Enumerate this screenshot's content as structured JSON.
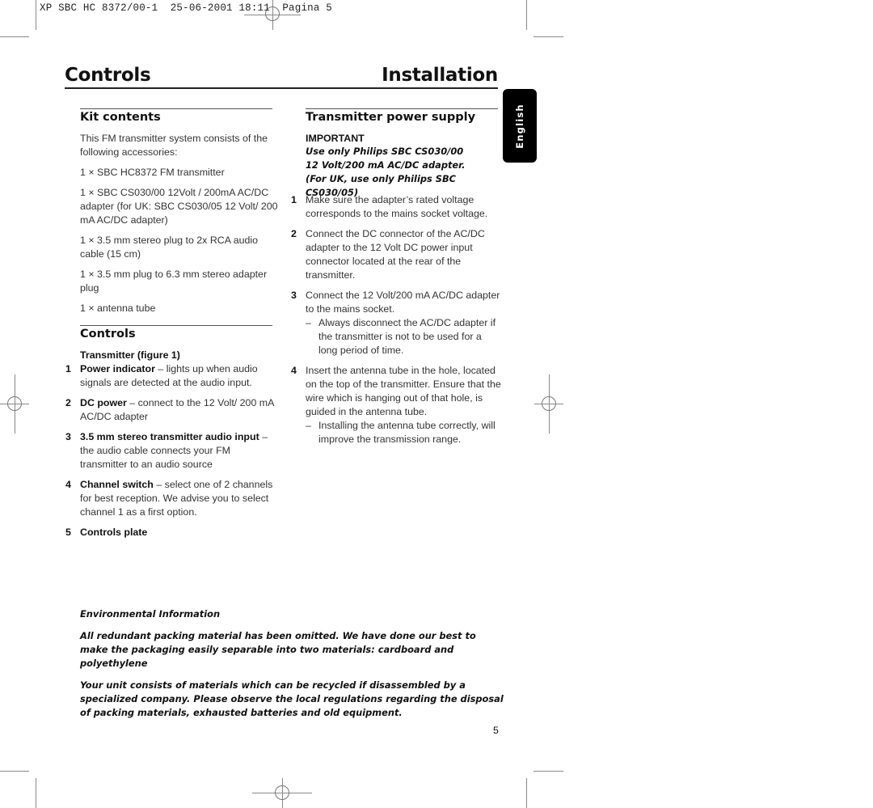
{
  "slug": {
    "text": "XP SBC HC 8372/00-1  25-06-2001 18:11  Pagina 5"
  },
  "header": {
    "left_title": "Controls",
    "right_title": "Installation"
  },
  "language_tab": {
    "label": "English",
    "color": "#000000"
  },
  "kit_contents": {
    "heading": "Kit contents",
    "intro": "This FM transmitter system consists of the following accessories:",
    "items": [
      "1 × SBC HC8372 FM transmitter",
      "1 × SBC CS030/00 12Volt / 200mA AC/DC adapter (for UK: SBC CS030/05 12 Volt/ 200 mA AC/DC adapter)",
      "1 × 3.5 mm stereo plug to 2x RCA audio cable (15 cm)",
      "1 × 3.5 mm plug to 6.3 mm stereo adapter plug",
      "1 × antenna tube"
    ]
  },
  "controls": {
    "heading": "Controls",
    "subheading": "Transmitter (figure 1)",
    "items": [
      {
        "num": "1",
        "term": "Power indicator",
        "desc": " – lights up when audio signals are detected at the audio input."
      },
      {
        "num": "2",
        "term": "DC power",
        "desc": " – connect to the 12 Volt/ 200 mA AC/DC adapter"
      },
      {
        "num": "3",
        "term": "3.5 mm stereo transmitter audio input",
        "desc": " – the audio cable connects your FM transmitter to an audio source"
      },
      {
        "num": "4",
        "term": "Channel switch",
        "desc": " – select one of 2 channels for best reception. We advise you to select channel 1 as a first option."
      },
      {
        "num": "5",
        "term": "Controls plate",
        "desc": ""
      }
    ]
  },
  "power_supply": {
    "heading": "Transmitter power supply",
    "important_label": "IMPORTANT",
    "important_lines": [
      "Use only Philips SBC CS030/00",
      "12 Volt/200 mA AC/DC adapter.",
      "(For UK, use only Philips SBC CS030/05)"
    ],
    "steps": [
      {
        "num": "1",
        "text": "Make sure the adapter’s rated voltage corresponds to the mains socket voltage.",
        "note": ""
      },
      {
        "num": "2",
        "text": "Connect the DC connector of the AC/DC adapter to the 12 Volt DC power input connector located at the rear of the transmitter.",
        "note": ""
      },
      {
        "num": "3",
        "text": "Connect the 12 Volt/200 mA AC/DC adapter to the mains socket.",
        "note": "Always disconnect the AC/DC adapter if the transmitter is not to be used for a long period of time."
      },
      {
        "num": "4",
        "text": "Insert the antenna tube in the hole, located on the top of the transmitter. Ensure that the wire which is hanging out of that hole, is guided in the antenna tube.",
        "note": "Installing the antenna tube correctly, will improve the transmission range."
      }
    ],
    "dash": "–"
  },
  "environment": {
    "heading": "Environmental Information",
    "paragraphs": [
      "All redundant packing material has been omitted. We have done our best to make the packaging easily separable into two materials: cardboard and polyethylene",
      "Your unit consists of materials which can be recycled if disassembled by a specialized company. Please observe the local regulations regarding the disposal of packing materials, exhausted batteries and old equipment."
    ]
  },
  "page_number": "5"
}
